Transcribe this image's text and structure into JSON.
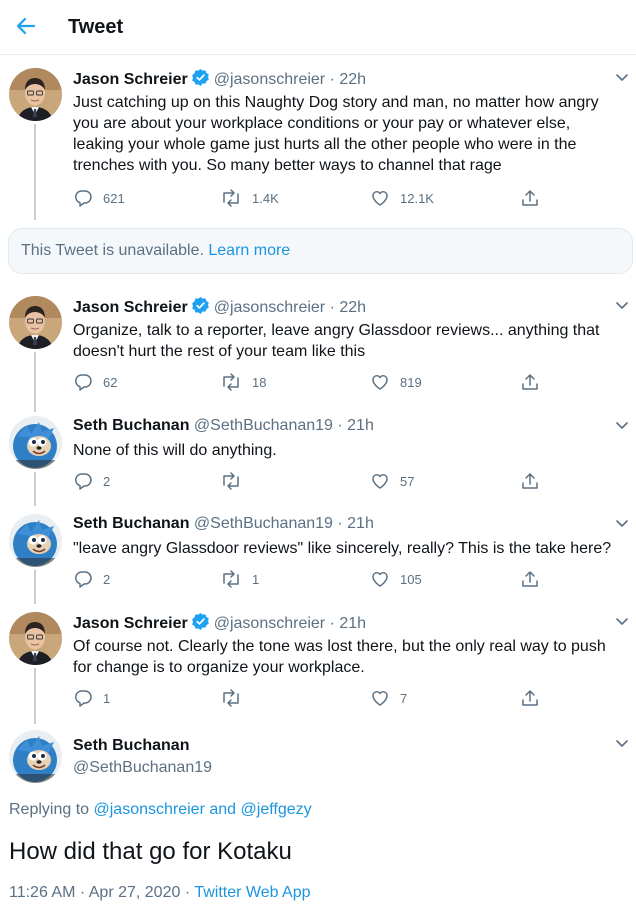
{
  "header": {
    "title": "Tweet"
  },
  "colors": {
    "accent": "#1da1f2",
    "muted": "#5b7083",
    "verified": "#1da1f2"
  },
  "tweets": [
    {
      "name": "Jason Schreier",
      "verified": true,
      "handle": "@jasonschreier",
      "time": "22h",
      "text": "Just catching up on this Naughty Dog story and man, no matter how angry you are about your workplace conditions or your pay or whatever else, leaking your whole game just hurts all the other people who were in the trenches with you. So many better ways to channel that rage",
      "replies": "621",
      "retweets": "1.4K",
      "likes": "12.1K"
    },
    {
      "name": "Jason Schreier",
      "verified": true,
      "handle": "@jasonschreier",
      "time": "22h",
      "text": "Organize, talk to a reporter, leave angry Glassdoor reviews... anything that doesn't hurt the rest of your team like this",
      "replies": "62",
      "retweets": "18",
      "likes": "819"
    },
    {
      "name": "Seth Buchanan",
      "verified": false,
      "handle": "@SethBuchanan19",
      "time": "21h",
      "text": "None of this will do anything.",
      "replies": "2",
      "retweets": "",
      "likes": "57"
    },
    {
      "name": "Seth Buchanan",
      "verified": false,
      "handle": "@SethBuchanan19",
      "time": "21h",
      "text": "\"leave angry Glassdoor reviews\" like sincerely, really? This is the take here?",
      "replies": "2",
      "retweets": "1",
      "likes": "105"
    },
    {
      "name": "Jason Schreier",
      "verified": true,
      "handle": "@jasonschreier",
      "time": "21h",
      "text": "Of course not. Clearly the tone was lost there, but the only real way to push for change is to organize your workplace.",
      "replies": "1",
      "retweets": "",
      "likes": "7"
    }
  ],
  "unavailable": {
    "text": "This Tweet is unavailable.",
    "link": "Learn more"
  },
  "main": {
    "name": "Seth Buchanan",
    "handle": "@SethBuchanan19",
    "replying_prefix": "Replying to",
    "replying_user1": "@jasonschreier",
    "replying_and": "and",
    "replying_user2": "@jeffgezy",
    "text": "How did that go for Kotaku",
    "timestamp": "11:26 AM · Apr 27, 2020 ·",
    "client": "Twitter Web App"
  }
}
